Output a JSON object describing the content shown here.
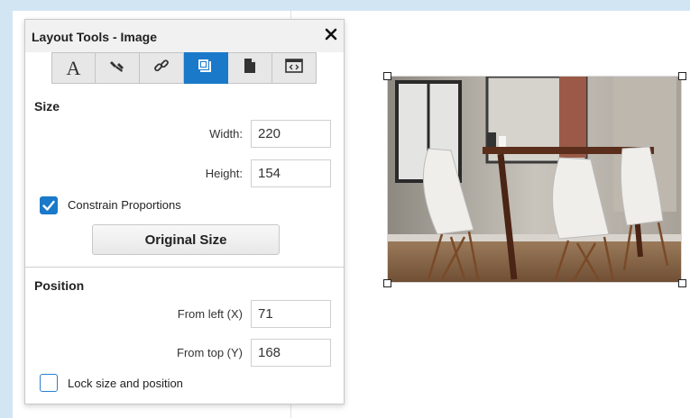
{
  "panel": {
    "title": "Layout Tools - Image",
    "tabs": [
      {
        "icon": "text-format-icon",
        "label": "A",
        "active": false
      },
      {
        "icon": "paint-brush-icon",
        "active": false
      },
      {
        "icon": "link-icon",
        "active": false
      },
      {
        "icon": "image-layout-icon",
        "active": true
      },
      {
        "icon": "page-icon",
        "active": false
      },
      {
        "icon": "embed-code-icon",
        "active": false
      }
    ],
    "size_section": {
      "label": "Size",
      "width_label": "Width:",
      "width_value": "220",
      "height_label": "Height:",
      "height_value": "154",
      "constrain_label": "Constrain Proportions",
      "constrain_checked": true,
      "original_size_button": "Original Size"
    },
    "position_section": {
      "label": "Position",
      "from_left_label": "From left (X)",
      "from_left_value": "71",
      "from_top_label": "From top (Y)",
      "from_top_value": "168",
      "lock_label": "Lock size and position",
      "lock_checked": false
    }
  },
  "image": {
    "icon": "dining-room-photo",
    "selected": true
  },
  "colors": {
    "accent": "#1a79c9",
    "background": "#d2e5f3"
  }
}
